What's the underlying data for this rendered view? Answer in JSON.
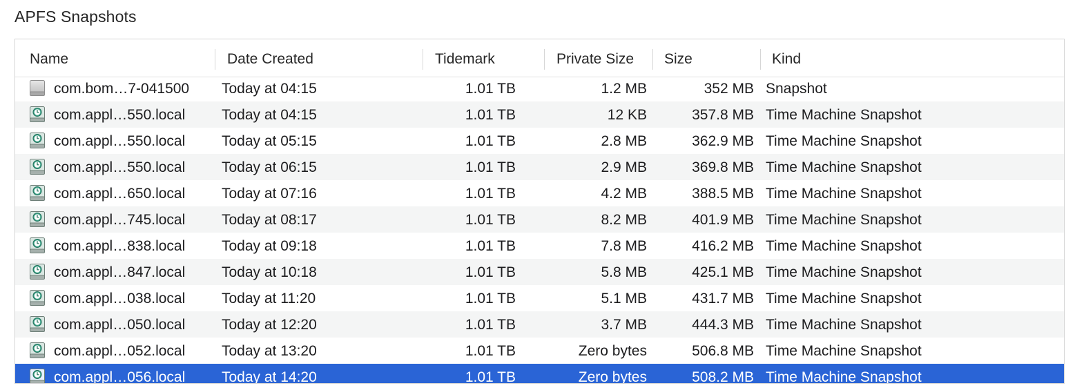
{
  "title": "APFS Snapshots",
  "columns": {
    "name": "Name",
    "date_created": "Date Created",
    "tidemark": "Tidemark",
    "private_size": "Private Size",
    "size": "Size",
    "kind": "Kind"
  },
  "colors": {
    "selection": "#2a64d6",
    "alternate_row": "#f4f5f5",
    "tm_icon_accent": "#3fa58a"
  },
  "rows": [
    {
      "icon": "snapshot-drive-icon",
      "name": "com.bom…7-041500",
      "date": "Today at 04:15",
      "tidemark": "1.01 TB",
      "private_size": "1.2 MB",
      "size": "352 MB",
      "kind": "Snapshot",
      "selected": false
    },
    {
      "icon": "time-machine-icon",
      "name": "com.appl…550.local",
      "date": "Today at 04:15",
      "tidemark": "1.01 TB",
      "private_size": "12 KB",
      "size": "357.8 MB",
      "kind": "Time Machine Snapshot",
      "selected": false
    },
    {
      "icon": "time-machine-icon",
      "name": "com.appl…550.local",
      "date": "Today at 05:15",
      "tidemark": "1.01 TB",
      "private_size": "2.8 MB",
      "size": "362.9 MB",
      "kind": "Time Machine Snapshot",
      "selected": false
    },
    {
      "icon": "time-machine-icon",
      "name": "com.appl…550.local",
      "date": "Today at 06:15",
      "tidemark": "1.01 TB",
      "private_size": "2.9 MB",
      "size": "369.8 MB",
      "kind": "Time Machine Snapshot",
      "selected": false
    },
    {
      "icon": "time-machine-icon",
      "name": "com.appl…650.local",
      "date": "Today at 07:16",
      "tidemark": "1.01 TB",
      "private_size": "4.2 MB",
      "size": "388.5 MB",
      "kind": "Time Machine Snapshot",
      "selected": false
    },
    {
      "icon": "time-machine-icon",
      "name": "com.appl…745.local",
      "date": "Today at 08:17",
      "tidemark": "1.01 TB",
      "private_size": "8.2 MB",
      "size": "401.9 MB",
      "kind": "Time Machine Snapshot",
      "selected": false
    },
    {
      "icon": "time-machine-icon",
      "name": "com.appl…838.local",
      "date": "Today at 09:18",
      "tidemark": "1.01 TB",
      "private_size": "7.8 MB",
      "size": "416.2 MB",
      "kind": "Time Machine Snapshot",
      "selected": false
    },
    {
      "icon": "time-machine-icon",
      "name": "com.appl…847.local",
      "date": "Today at 10:18",
      "tidemark": "1.01 TB",
      "private_size": "5.8 MB",
      "size": "425.1 MB",
      "kind": "Time Machine Snapshot",
      "selected": false
    },
    {
      "icon": "time-machine-icon",
      "name": "com.appl…038.local",
      "date": "Today at 11:20",
      "tidemark": "1.01 TB",
      "private_size": "5.1 MB",
      "size": "431.7 MB",
      "kind": "Time Machine Snapshot",
      "selected": false
    },
    {
      "icon": "time-machine-icon",
      "name": "com.appl…050.local",
      "date": "Today at 12:20",
      "tidemark": "1.01 TB",
      "private_size": "3.7 MB",
      "size": "444.3 MB",
      "kind": "Time Machine Snapshot",
      "selected": false
    },
    {
      "icon": "time-machine-icon",
      "name": "com.appl…052.local",
      "date": "Today at 13:20",
      "tidemark": "1.01 TB",
      "private_size": "Zero bytes",
      "size": "506.8 MB",
      "kind": "Time Machine Snapshot",
      "selected": false
    },
    {
      "icon": "time-machine-icon",
      "name": "com.appl…056.local",
      "date": "Today at 14:20",
      "tidemark": "1.01 TB",
      "private_size": "Zero bytes",
      "size": "508.2 MB",
      "kind": "Time Machine Snapshot",
      "selected": true
    }
  ]
}
